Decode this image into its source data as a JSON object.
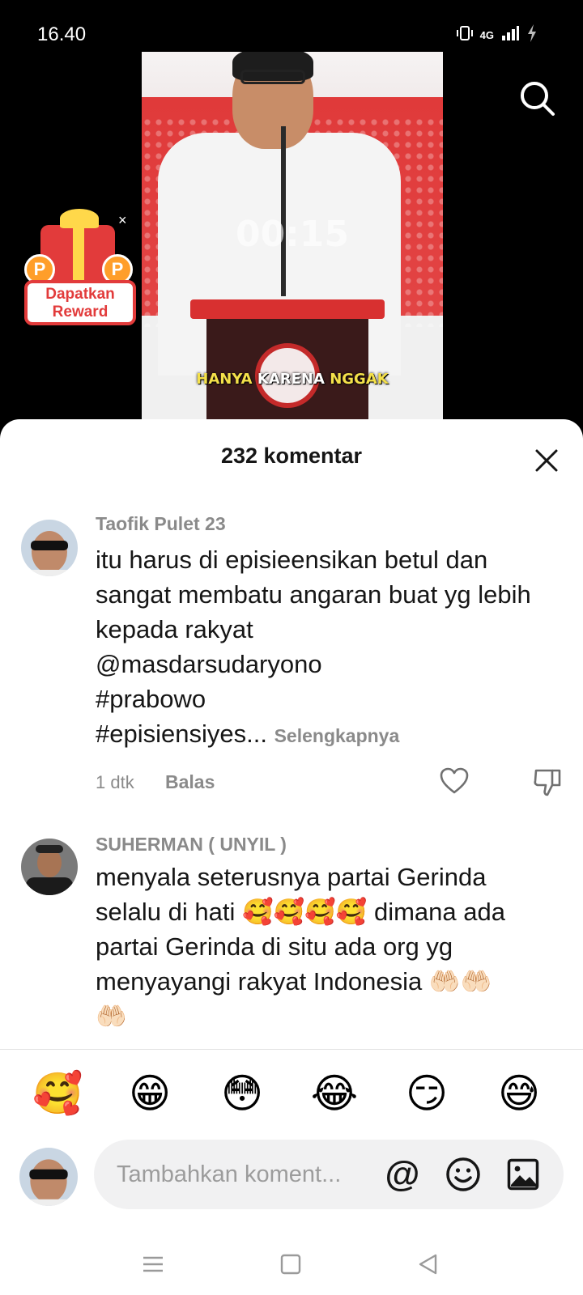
{
  "status": {
    "time": "16.40",
    "network": "4G"
  },
  "video": {
    "timer": "00:15",
    "caption_yellow": "HANYA",
    "caption_white": "KARENA",
    "caption_yellow2": "NGGAK"
  },
  "reward": {
    "line1": "Dapatkan",
    "line2": "Reward",
    "close_glyph": "×"
  },
  "comments_header": {
    "title": "232 komentar"
  },
  "comments": [
    {
      "username": "Taofik Pulet 23",
      "text": "itu harus di episieensikan betul dan sangat membatu angaran buat yg lebih kepada rakyat",
      "mention": "@masdarsudaryono",
      "hashtag1": "#prabowo",
      "hashtag2": "#episiensiyes...",
      "see_more": "Selengkapnya",
      "time": "1 dtk",
      "reply": "Balas"
    },
    {
      "username": "SUHERMAN ( UNYIL )",
      "line1": "menyala seterusnya partai Gerinda",
      "line2a": "selalu di hati ",
      "line2_emojis": "🥰🥰🥰🥰",
      "line2b": " dimana ada",
      "line3": "partai Gerinda di situ ada org yg",
      "line4a": "menyayangi rakyat Indonesia ",
      "line4_emojis": "🤲🏻🤲🏻",
      "line5_emojis": "🤲🏻"
    }
  ],
  "quick_emojis": [
    "🥰",
    "😁",
    "😳",
    "😂",
    "😏",
    "😅"
  ],
  "input": {
    "placeholder": "Tambahkan koment..."
  },
  "colors": {
    "accent_red": "#e23b3b",
    "muted_text": "#8a8a8a",
    "text": "#161616",
    "input_bg": "#f1f1f2"
  }
}
